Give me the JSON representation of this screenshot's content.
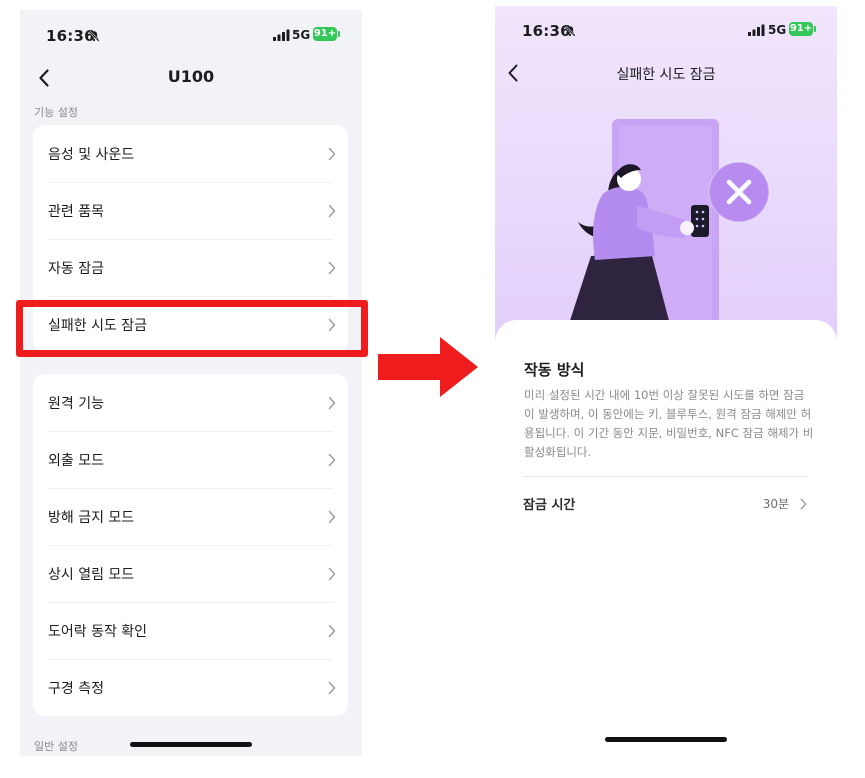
{
  "left": {
    "status": {
      "time": "16:36",
      "network": "5G",
      "battery": "91+"
    },
    "header": {
      "title": "U100"
    },
    "sections": [
      {
        "label": "기능 설정"
      },
      {
        "label": "일반 설정"
      }
    ],
    "group1": [
      "음성 및 사운드",
      "관련 품목",
      "자동 잠금",
      "실패한 시도 잠금"
    ],
    "group2": [
      "원격 기능",
      "외출 모드",
      "방해 금지 모드",
      "상시 열림 모드",
      "도어락 동작 확인",
      "구경 측정"
    ]
  },
  "right": {
    "status": {
      "time": "16:36",
      "network": "5G",
      "battery": "91+"
    },
    "header": {
      "title": "실패한 시도 잠금"
    },
    "sheet": {
      "title": "작동 방식",
      "description": "미리 설정된 시간 내에 10번 이상 잘못된 시도를 하면 잠금이 발생하며, 이 동안에는 키, 블루투스, 원격 잠금 해제만 허용됩니다. 이 기간 동안 지문, 비밀번호, NFC 잠금 해제가 비활성화됩니다.",
      "lock_time": {
        "label": "잠금 시간",
        "value": "30분"
      }
    }
  },
  "colors": {
    "highlight": "#ee1c1c",
    "arrow": "#ee1c1c",
    "battery": "#34c759",
    "hero_purple": "#e2cffa",
    "door": "#c9a3f4",
    "close_badge": "#b88bf0"
  },
  "icons": [
    "bell-slash-icon",
    "signal-icon",
    "battery-icon",
    "back-chevron-icon",
    "chevron-right-icon",
    "close-x-icon"
  ]
}
